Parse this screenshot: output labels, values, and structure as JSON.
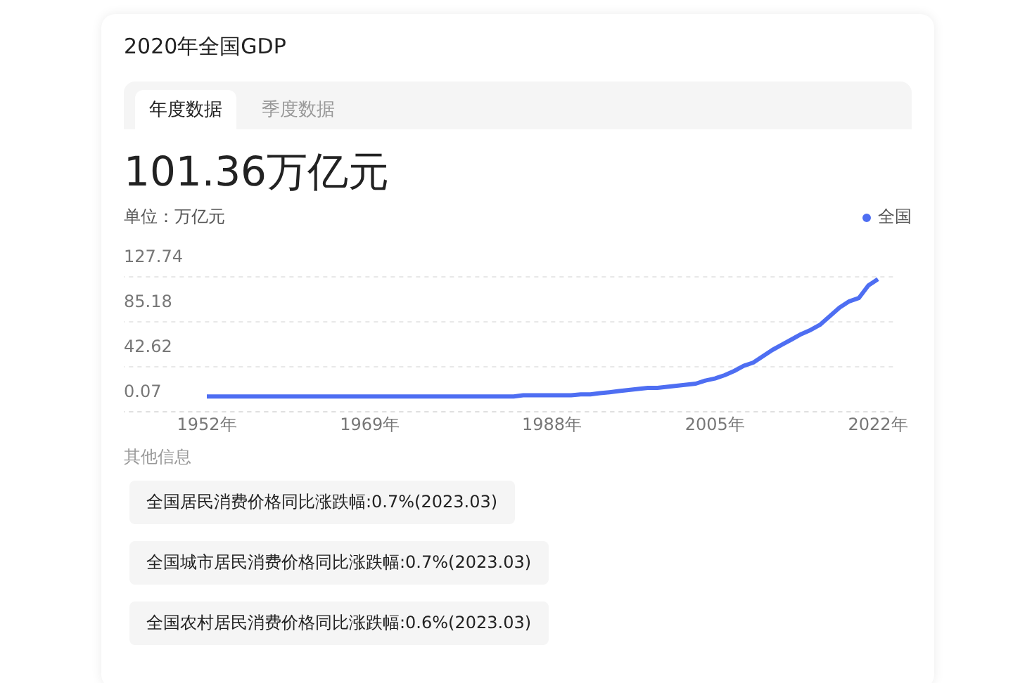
{
  "card": {
    "title": "2020年全国GDP",
    "tabs": [
      {
        "label": "年度数据",
        "selected": true
      },
      {
        "label": "季度数据",
        "selected": false
      }
    ],
    "headline": "101.36万亿元",
    "unit": "单位：万亿元",
    "chart_data": {
      "type": "line",
      "x": [
        1952,
        1953,
        1954,
        1955,
        1956,
        1957,
        1958,
        1959,
        1960,
        1961,
        1962,
        1963,
        1964,
        1965,
        1966,
        1967,
        1968,
        1969,
        1970,
        1971,
        1972,
        1973,
        1974,
        1975,
        1976,
        1977,
        1978,
        1979,
        1980,
        1981,
        1982,
        1983,
        1984,
        1985,
        1986,
        1987,
        1988,
        1989,
        1990,
        1991,
        1992,
        1993,
        1994,
        1995,
        1996,
        1997,
        1998,
        1999,
        2000,
        2001,
        2002,
        2003,
        2004,
        2005,
        2006,
        2007,
        2008,
        2009,
        2010,
        2011,
        2012,
        2013,
        2014,
        2015,
        2016,
        2017,
        2018,
        2019,
        2020,
        2021,
        2022
      ],
      "series": [
        {
          "name": "全国",
          "color": "#4e6ef2",
          "values": [
            -4,
            -4,
            -4,
            -4,
            -4,
            -4,
            -4,
            -4,
            -4,
            -4,
            -4,
            -4,
            -4,
            -4,
            -4,
            -4,
            -4,
            -4,
            -4,
            -4,
            -4,
            -4,
            -4,
            -4,
            -4,
            -4,
            -4,
            -4,
            -4,
            -4,
            -4,
            -4,
            -4,
            -3,
            -3,
            -3,
            -3,
            -3,
            -3,
            -2,
            -2,
            -1,
            0,
            1,
            2,
            3,
            4,
            4,
            5,
            6,
            7,
            8,
            11,
            13,
            16,
            20,
            25,
            28,
            34,
            40,
            45,
            50,
            55,
            59,
            64,
            72,
            80,
            86,
            89,
            101,
            107
          ]
        }
      ],
      "xlim": [
        1943,
        2024
      ],
      "ylim": [
        -18.55,
        127.74
      ],
      "xticks": [
        {
          "value": 1952,
          "label": "1952年"
        },
        {
          "value": 1969,
          "label": "1969年"
        },
        {
          "value": 1988,
          "label": "1988年"
        },
        {
          "value": 2005,
          "label": "2005年"
        },
        {
          "value": 2022,
          "label": "2022年"
        }
      ],
      "yticks": [
        0.07,
        42.62,
        85.18,
        127.74
      ]
    },
    "other_heading": "其他信息",
    "other_items": [
      "全国居民消费价格同比涨跌幅:0.7%(2023.03)",
      "全国城市居民消费价格同比涨跌幅:0.7%(2023.03)",
      "全国农村居民消费价格同比涨跌幅:0.6%(2023.03)"
    ]
  }
}
